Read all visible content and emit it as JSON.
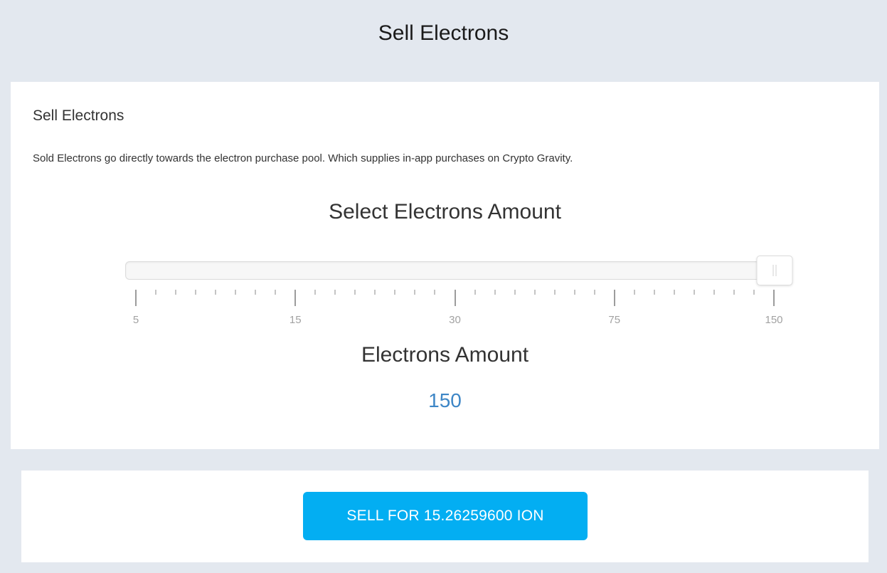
{
  "header": {
    "title": "Sell Electrons"
  },
  "main_panel": {
    "title": "Sell Electrons",
    "description": "Sold Electrons go directly towards the electron purchase pool. Which supplies in-app purchases on Crypto Gravity.",
    "select_heading": "Select Electrons Amount",
    "slider": {
      "options": [
        "5",
        "15",
        "30",
        "75",
        "150"
      ],
      "selected_index": 4,
      "selected_value": "150",
      "minor_ticks_between": 7
    },
    "amount_heading": "Electrons Amount",
    "amount_value": "150"
  },
  "action_panel": {
    "sell_button_label": "SELL FOR 15.26259600 ION"
  },
  "colors": {
    "background": "#e3e8ef",
    "panel": "#ffffff",
    "accent_button": "#03aef2",
    "amount_value": "#3d86c6"
  }
}
